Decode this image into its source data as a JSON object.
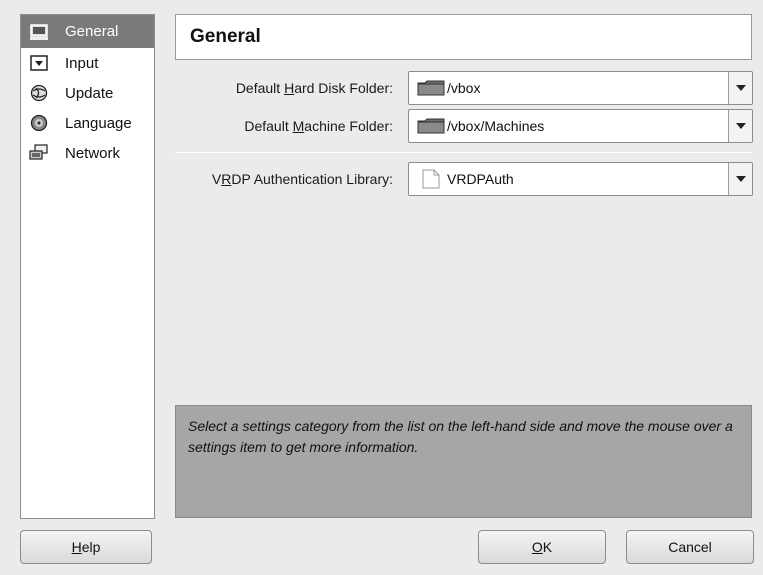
{
  "sidebar": {
    "items": [
      {
        "label": "General",
        "icon": "monitor-icon",
        "selected": true
      },
      {
        "label": "Input",
        "icon": "keyboard-icon",
        "selected": false
      },
      {
        "label": "Update",
        "icon": "globe-update-icon",
        "selected": false
      },
      {
        "label": "Language",
        "icon": "globe-language-icon",
        "selected": false
      },
      {
        "label": "Network",
        "icon": "network-icon",
        "selected": false
      }
    ]
  },
  "page": {
    "title": "General"
  },
  "fields": {
    "hard_disk": {
      "label_pre": "Default ",
      "label_mnemonic": "H",
      "label_post": "ard Disk Folder:",
      "value": "/vbox",
      "icon": "folder-icon"
    },
    "machine": {
      "label_pre": "Default ",
      "label_mnemonic": "M",
      "label_post": "achine Folder:",
      "value": "/vbox/Machines",
      "icon": "folder-icon"
    },
    "vrdp": {
      "label_pre": "V",
      "label_mnemonic": "R",
      "label_post": "DP Authentication Library:",
      "value": "VRDPAuth",
      "icon": "file-icon"
    }
  },
  "info": {
    "text": "Select a settings category from the list on the left-hand side and move the mouse over a settings item to get more information."
  },
  "buttons": {
    "help": {
      "mnemonic": "H",
      "rest": "elp"
    },
    "ok": {
      "mnemonic": "O",
      "rest": "K"
    },
    "cancel": {
      "label": "Cancel"
    }
  },
  "colors": {
    "selected_bg": "#7a7a7a",
    "info_bg": "#a6a6a6",
    "window_bg": "#ebebeb"
  }
}
